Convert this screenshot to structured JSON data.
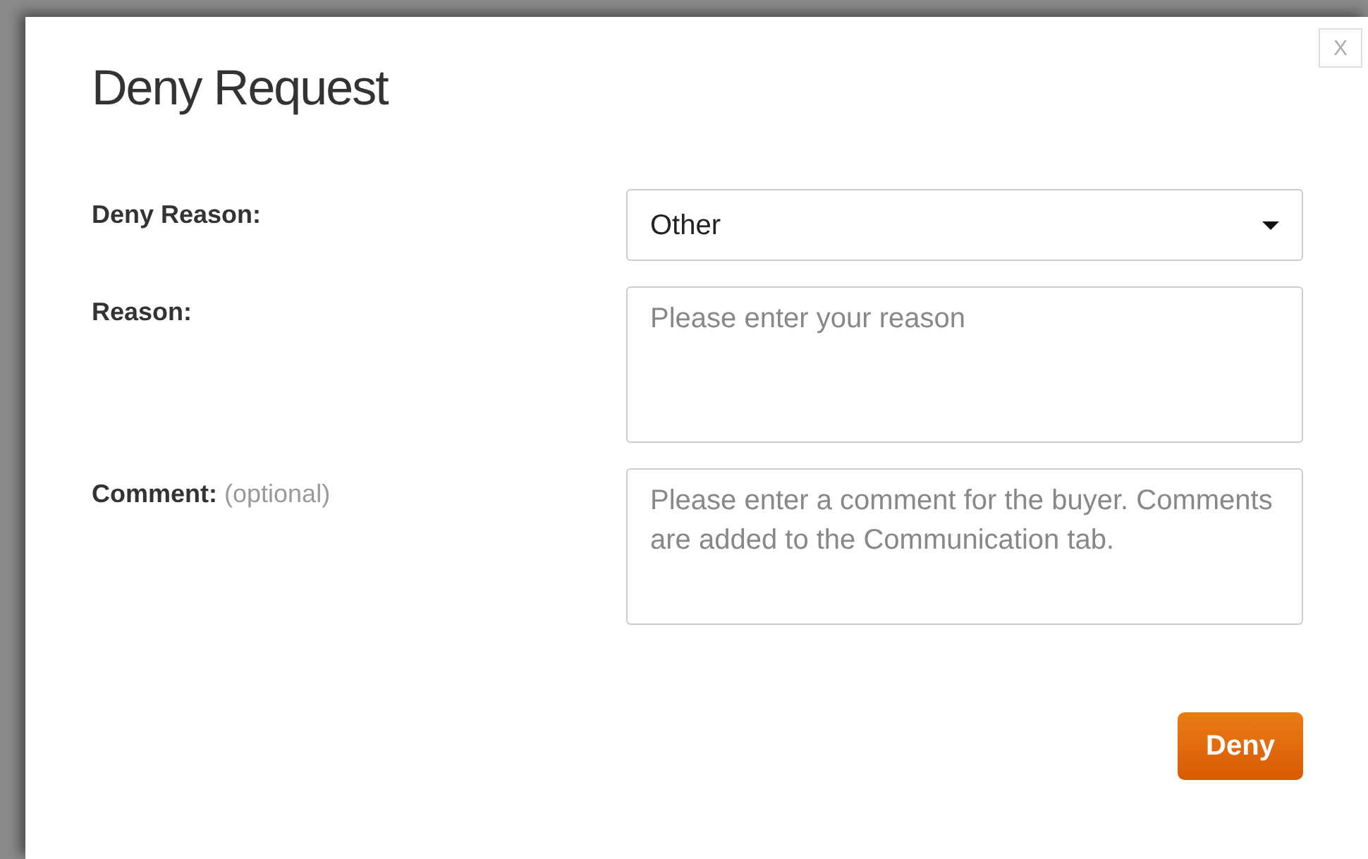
{
  "dialog": {
    "title": "Deny Request",
    "close_label": "X"
  },
  "fields": [
    {
      "kind": "select",
      "label": "Deny Reason:",
      "value": "Other"
    },
    {
      "kind": "textarea",
      "label": "Reason:",
      "placeholder": "Please enter your reason"
    },
    {
      "kind": "textarea",
      "label": "Comment:",
      "hint": "(optional)",
      "placeholder": "Please enter a comment for the buyer. Comments are added to the Communication tab."
    }
  ],
  "buttons": [
    "Deny"
  ]
}
